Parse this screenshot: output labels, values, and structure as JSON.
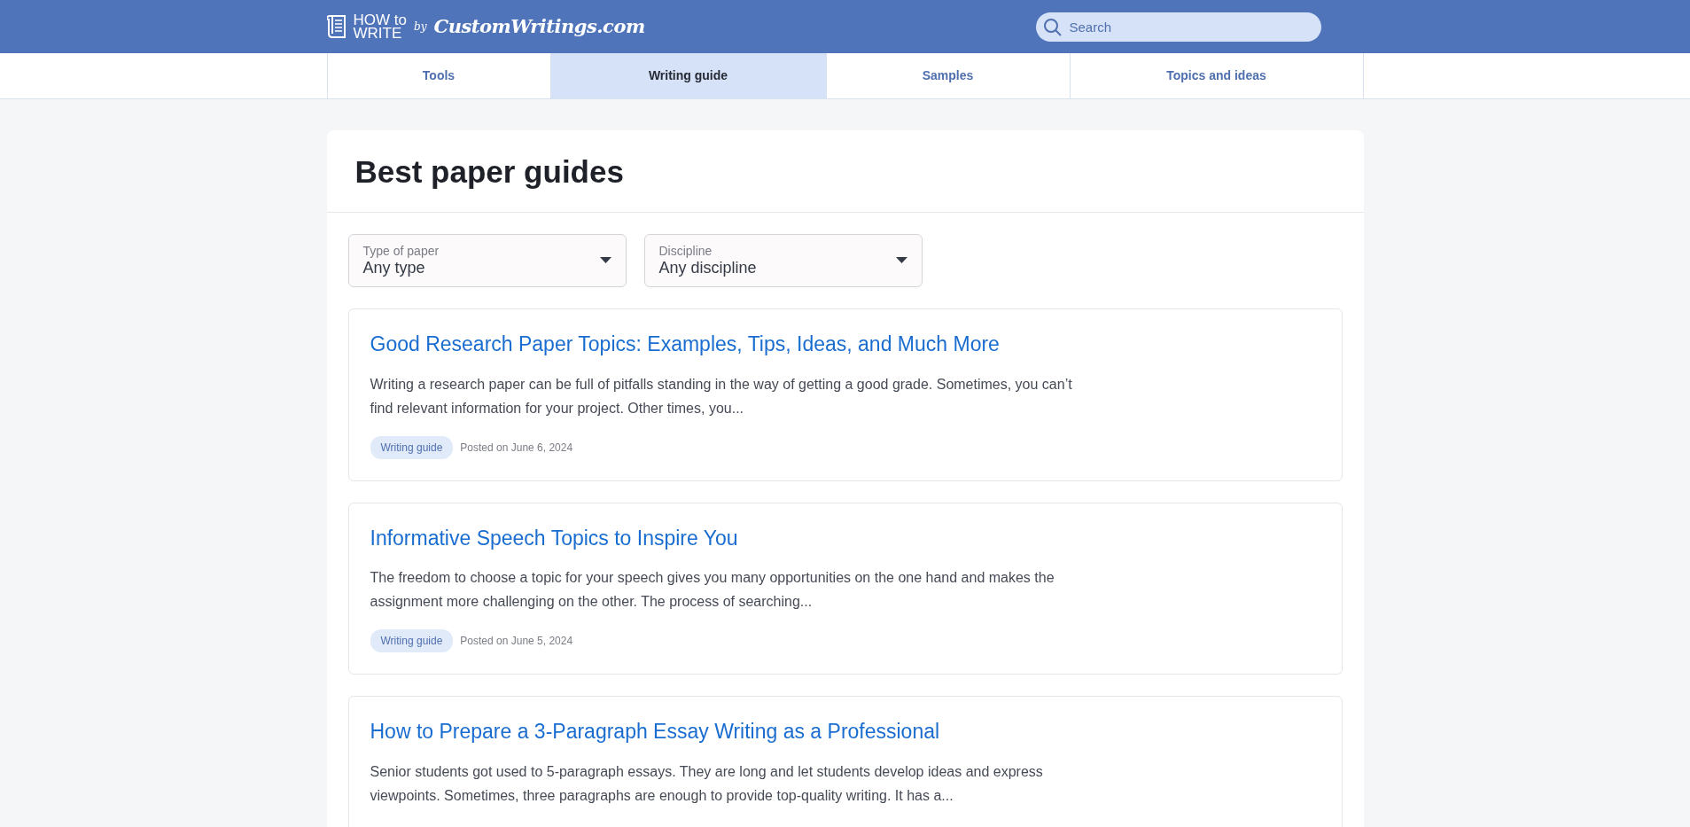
{
  "header": {
    "logo_top": "HOW to",
    "logo_bottom": "WRITE",
    "logo_by": "by",
    "logo_brand": "CustomWritings.com",
    "search": {
      "placeholder": "Search"
    }
  },
  "nav_tabs": [
    {
      "label": "Tools",
      "selected": false
    },
    {
      "label": "Writing guide",
      "selected": true
    },
    {
      "label": "Samples",
      "selected": false
    },
    {
      "label": "Topics and ideas",
      "selected": false
    }
  ],
  "page_title": "Best paper guides",
  "filters": [
    {
      "label": "Type of paper",
      "value": "Any type"
    },
    {
      "label": "Discipline",
      "value": "Any discipline"
    }
  ],
  "articles": [
    {
      "title": "Good Research Paper Topics: Examples, Tips, Ideas, and Much More",
      "excerpt": "Writing a research paper can be full of pitfalls standing in the way of getting a good grade. Sometimes, you can’t find relevant information for your project. Other times, you...",
      "tag": "Writing guide",
      "date": "Posted on June 6, 2024"
    },
    {
      "title": "Informative Speech Topics to Inspire You",
      "excerpt": "The freedom to choose a topic for your speech gives you many opportunities on the one hand and makes the assignment more challenging on the other. The process of searching...",
      "tag": "Writing guide",
      "date": "Posted on June 5, 2024"
    },
    {
      "title": "How to Prepare a 3-Paragraph Essay Writing as a Professional",
      "excerpt": "Senior students got used to 5-paragraph essays. They are long and let students develop ideas and express viewpoints. Sometimes, three paragraphs are enough to provide top-quality writing. It has a..."
    }
  ]
}
